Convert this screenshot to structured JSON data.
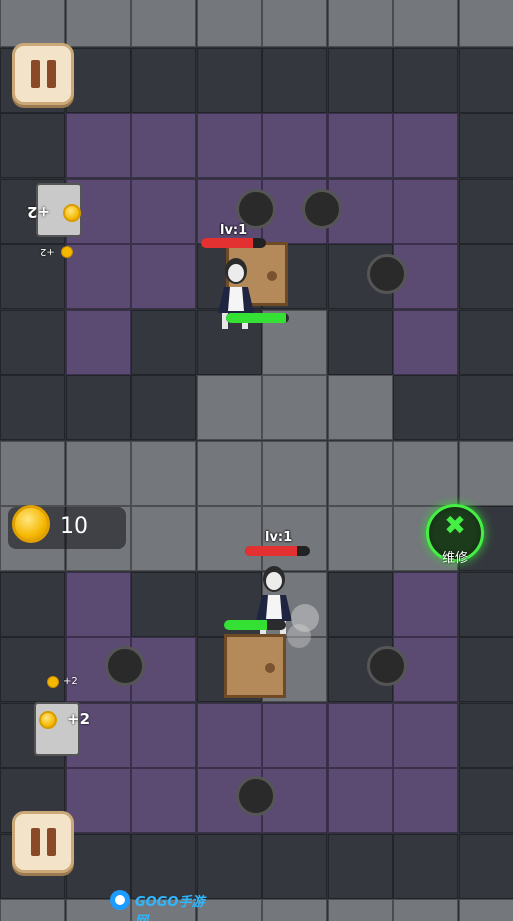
{
  "hud": {
    "coins": "10",
    "repair_label": "维修",
    "icons": {
      "pause": "pause-icon",
      "coin": "coin-icon",
      "repair": "wrench-icon"
    }
  },
  "players": [
    {
      "level_label": "lv:1",
      "hp": 0.8,
      "build_progress": 0.95
    },
    {
      "level_label": "lv:1",
      "hp": 0.8,
      "build_progress": 0.7
    }
  ],
  "coin_gains": {
    "large": "+2",
    "small": "+2"
  },
  "watermark": {
    "text": "GOGO手游网"
  },
  "colors": {
    "floor_gray": "#74777c",
    "floor_dark": "#34383e",
    "room_purple": "#5b4b73",
    "hp_red": "#e33030",
    "progress_green": "#34e034",
    "repair_green": "#45f045",
    "coin_gold": "#f5b800"
  }
}
